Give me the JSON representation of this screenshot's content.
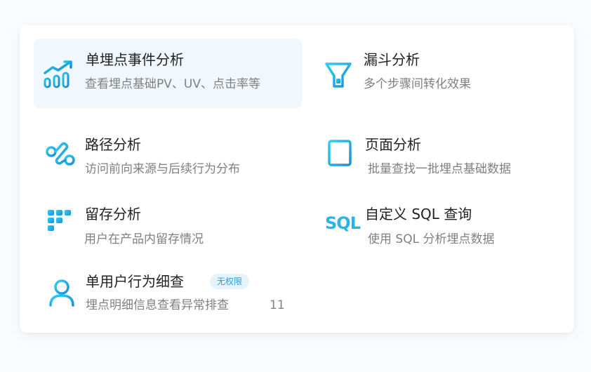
{
  "features": {
    "event_analysis": {
      "title": "单埋点事件分析",
      "desc": "查看埋点基础PV、UV、点击率等",
      "icon": "bar-chart-trend-icon"
    },
    "funnel_analysis": {
      "title": "漏斗分析",
      "desc": "多个步骤间转化效果",
      "icon": "funnel-icon"
    },
    "path_analysis": {
      "title": "路径分析",
      "desc": "访问前向来源与后续行为分布",
      "icon": "path-icon"
    },
    "page_analysis": {
      "title": "页面分析",
      "desc": "批量查找一批埋点基础数据",
      "icon": "page-layout-icon"
    },
    "retention_analysis": {
      "title": "留存分析",
      "desc": "用户在产品内留存情况",
      "icon": "grid-dots-icon"
    },
    "sql_query": {
      "title": "自定义 SQL 查询",
      "desc": "使用 SQL 分析埋点数据",
      "icon": "sql-icon",
      "glyph": "SQL"
    },
    "user_behavior": {
      "title": "单用户行为细查",
      "desc": "埋点明细信息查看异常排查",
      "icon": "user-icon",
      "badge": "无权限",
      "count": "11"
    }
  },
  "colors": {
    "accent": "#29b3e6",
    "accent_dark": "#1e88d6",
    "active_bg": "#f1f8fd"
  }
}
